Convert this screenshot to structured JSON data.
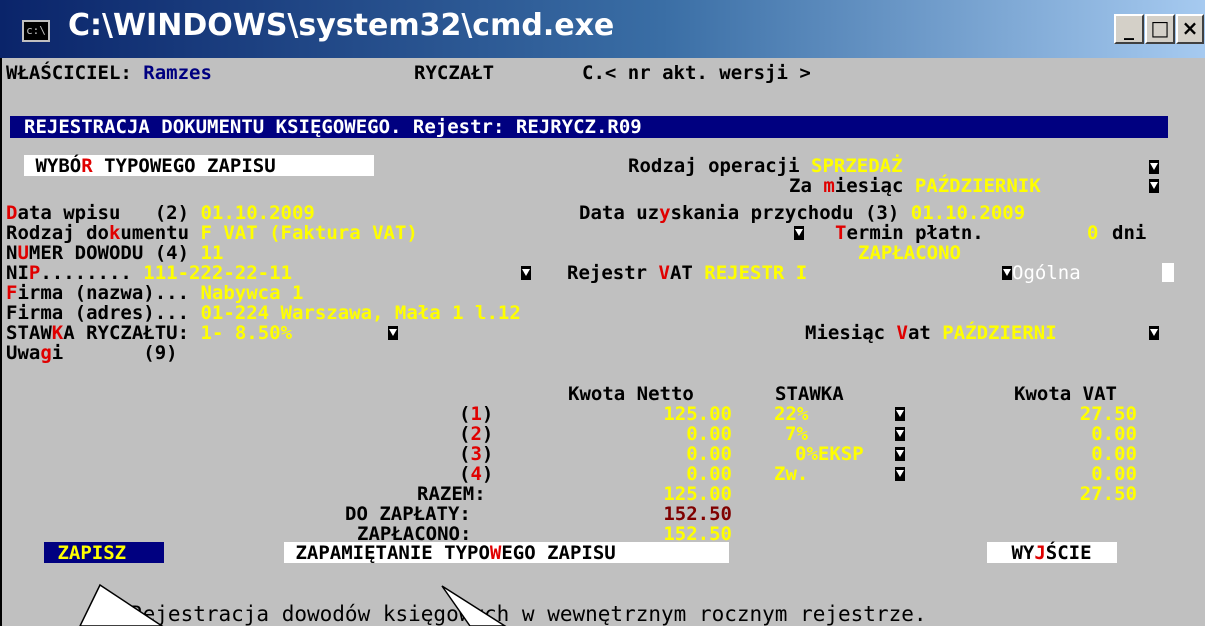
{
  "window": {
    "title": "C:\\WINDOWS\\system32\\cmd.exe",
    "icon_label": "c:\\",
    "minimize": "_",
    "maximize": "□",
    "close": "×"
  },
  "status": {
    "owner_label": "WŁAŚCICIEL:",
    "owner_value": "Ramzes",
    "mode": "RYCZAŁT",
    "version": "C.< nr akt. wersji >"
  },
  "header": "REJESTRACJA DOKUMENTU KSIĘGOWEGO. Rejestr: REJRYCZ.R09",
  "typical_button": {
    "pre": " WYBÓ",
    "hot": "R",
    "post": " TYPOWEGO ZAPISU "
  },
  "operation": {
    "label": "Rodzaj operacji ",
    "value": "SPRZEDAŻ"
  },
  "month": {
    "pre": "Za ",
    "hot": "m",
    "post": "iesiąc ",
    "value": "PAŹDZIERNIK"
  },
  "entry_date": {
    "hot": "D",
    "label": "ata wpisu   (2) ",
    "value": "01.10.2009"
  },
  "income_date": {
    "pre": "Data uz",
    "hot": "y",
    "post": "skania przychodu (3) ",
    "value": "01.10.2009"
  },
  "doc_type": {
    "pre": "Rodzaj do",
    "hot": "k",
    "post": "umentu ",
    "value": "F VAT (Faktura VAT)"
  },
  "payment_term": {
    "hot": "T",
    "label": "ermin płatn.",
    "value": "0",
    "unit": "dni"
  },
  "doc_number": {
    "pre": "N",
    "hot": "U",
    "post": "MER DOWODU (4) ",
    "value": "11"
  },
  "paid_status": "ZAPŁACONO",
  "nip": {
    "pre": "NI",
    "hot": "P",
    "post": "........ ",
    "value": "111-222-22-11"
  },
  "vat_register": {
    "pre": "Rejestr ",
    "hot": "V",
    "post": "AT ",
    "value": "REJESTR I",
    "kind": "Ogólna"
  },
  "company_name": {
    "hot": "F",
    "label": "irma (nazwa)... ",
    "value": "Nabywca 1"
  },
  "company_address": {
    "label": "Firma (adres)... ",
    "value": "01-224 Warszawa, Mała 1 l.12"
  },
  "lump_rate": {
    "pre": "STAW",
    "hot": "K",
    "post": "A RYCZAŁTU: ",
    "value": "1- 8.50%"
  },
  "vat_month": {
    "pre": "Miesiąc ",
    "hot": "V",
    "post": "at ",
    "value": "PAŹDZIERNI"
  },
  "notes": {
    "pre": "Uwa",
    "hot": "g",
    "post": "i       (9)"
  },
  "table": {
    "headers": {
      "net": "Kwota Netto",
      "rate": "STAWKA",
      "vat": "Kwota VAT"
    },
    "rows": [
      {
        "pre": "(",
        "num": "1",
        "post": ")",
        "net": "125.00",
        "rate": "22%",
        "vat": "27.50"
      },
      {
        "pre": "(",
        "num": "2",
        "post": ")",
        "net": "0.00",
        "rate": "7%",
        "vat": "0.00"
      },
      {
        "pre": "(",
        "num": "3",
        "post": ")",
        "net": "0.00",
        "rate": "0%EKSP",
        "vat": "0.00"
      },
      {
        "pre": "(",
        "num": "4",
        "post": ")",
        "net": "0.00",
        "rate": "Zw.",
        "vat": "0.00"
      }
    ],
    "total_label": "RAZEM:",
    "total_net": "125.00",
    "total_vat": "27.50",
    "to_pay_label": "DO ZAPŁATY:",
    "to_pay": "152.50",
    "paid_label": "ZAPŁACONO:",
    "paid": "152.50"
  },
  "buttons": {
    "save": " ZAPISZ ",
    "remember": {
      "pre": " ZAPAMIĘTANIE TYPO",
      "hot": "W",
      "post": "EGO ZAPISU "
    },
    "exit": {
      "pre": " WY",
      "hot": "J",
      "post": "ŚCIE "
    }
  },
  "footer_hint": "Rejestracja dowodów księgowych w wewnętrznym rocznym rejestrze.",
  "colors": {
    "console_bg": "#c0c0c0",
    "value": "#ffff00",
    "header_bg": "#000080",
    "hotkey": "#e00000",
    "to_pay": "#800000"
  }
}
